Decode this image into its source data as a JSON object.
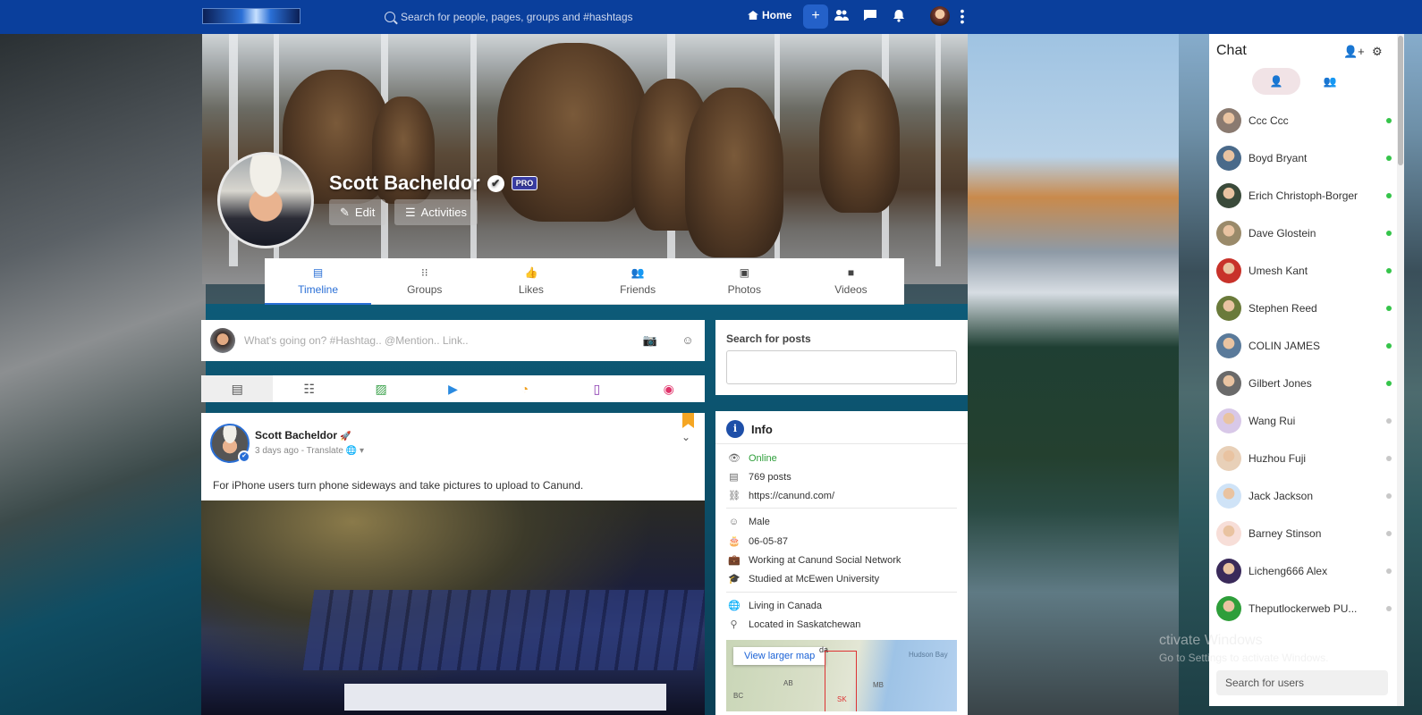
{
  "topbar": {
    "search_placeholder": "Search for people, pages, groups and #hashtags",
    "home_label": "Home",
    "plus_label": "+",
    "icons": [
      "friends-icon",
      "messages-icon",
      "notifications-icon"
    ]
  },
  "profile": {
    "name": "Scott Bacheldor",
    "verified_glyph": "✔",
    "badge": "PRO",
    "edit_label": "Edit",
    "activities_label": "Activities"
  },
  "tabs": [
    {
      "label": "Timeline",
      "icon": "▤"
    },
    {
      "label": "Groups",
      "icon": "⁝⁝"
    },
    {
      "label": "Likes",
      "icon": "👍"
    },
    {
      "label": "Friends",
      "icon": "👥"
    },
    {
      "label": "Photos",
      "icon": "▣"
    },
    {
      "label": "Videos",
      "icon": "■"
    }
  ],
  "composer": {
    "placeholder": "What's going on? #Hashtag.. @Mention.. Link.."
  },
  "post_types": [
    {
      "icon": "▤",
      "color": "#555555"
    },
    {
      "icon": "☷",
      "color": "#555555"
    },
    {
      "icon": "▨",
      "color": "#3aa14a"
    },
    {
      "icon": "▶",
      "color": "#2a8ae0"
    },
    {
      "icon": "◔",
      "color": "#f0a020"
    },
    {
      "icon": "▯",
      "color": "#8a3ab0"
    },
    {
      "icon": "◉",
      "color": "#e0336a"
    }
  ],
  "post": {
    "author": "Scott Bacheldor",
    "author_icon": "🚀",
    "meta": "3 days ago - Translate",
    "meta_icons": "🌐 ▾",
    "text": "For iPhone users turn phone sideways and take pictures to upload to Canund."
  },
  "search_posts": {
    "title": "Search for posts"
  },
  "info": {
    "title": "Info",
    "icon": "i",
    "rows": [
      {
        "icon": "👁",
        "text": "Online"
      },
      {
        "icon": "▤",
        "text": "769 posts"
      },
      {
        "icon": "⛓",
        "text": "https://canund.com/"
      },
      {
        "icon": "☺",
        "text": "Male"
      },
      {
        "icon": "🎂",
        "text": "06-05-87"
      },
      {
        "icon": "💼",
        "text": "Working at Canund Social Network"
      },
      {
        "icon": "🎓",
        "text": "Studied at McEwen University"
      },
      {
        "icon": "🌐",
        "text": "Living in Canada"
      },
      {
        "icon": "⚲",
        "text": "Located in Saskatchewan"
      }
    ],
    "map": {
      "button": "View larger map",
      "labels": [
        "da",
        "Hudson Bay",
        "AB",
        "MB",
        "BC",
        "SK"
      ]
    }
  },
  "chat": {
    "title": "Chat",
    "header_icons": [
      "👤+",
      "⚙"
    ],
    "tab_icons": [
      "👤",
      "👥"
    ],
    "users": [
      {
        "name": "Ccc Ccc",
        "online": true,
        "color": "#8a7a70"
      },
      {
        "name": "Boyd Bryant",
        "online": true,
        "color": "#4a6a8a"
      },
      {
        "name": "Erich Christoph-Borger",
        "online": true,
        "color": "#3a4a3a"
      },
      {
        "name": "Dave Glostein",
        "online": true,
        "color": "#9a8a6a"
      },
      {
        "name": "Umesh Kant",
        "online": true,
        "color": "#c8322a"
      },
      {
        "name": "Stephen Reed",
        "online": true,
        "color": "#6a7a3a"
      },
      {
        "name": "COLIN JAMES",
        "online": true,
        "color": "#5a7a9a"
      },
      {
        "name": "Gilbert Jones",
        "online": true,
        "color": "#6a6a6a"
      },
      {
        "name": "Wang Rui",
        "online": false,
        "color": "#d8c8e8"
      },
      {
        "name": "Huzhou Fuji",
        "online": false,
        "color": "#e8d0b8"
      },
      {
        "name": "Jack Jackson",
        "online": false,
        "color": "#cfe3f7"
      },
      {
        "name": "Barney Stinson",
        "online": false,
        "color": "#f7ded8"
      },
      {
        "name": "Licheng666 Alex",
        "online": false,
        "color": "#3a2a5a"
      },
      {
        "name": "Theputlockerweb PU...",
        "online": false,
        "color": "#2e9e3a"
      }
    ],
    "status_colors": {
      "online": "#35c44a",
      "offline": "#c8c8c8"
    },
    "search_placeholder": "Search for users"
  },
  "watermark": {
    "line1": "ctivate Windows",
    "line2": "Go to Settings to activate Windows."
  }
}
